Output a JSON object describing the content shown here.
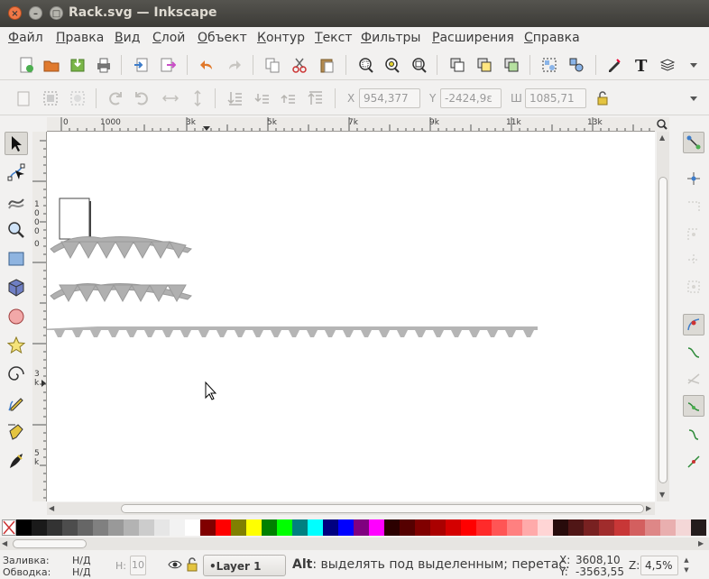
{
  "window": {
    "title": "Rack.svg — Inkscape"
  },
  "menu": [
    "Файл",
    "Правка",
    "Вид",
    "Слой",
    "Объект",
    "Контур",
    "Текст",
    "Фильтры",
    "Расширения",
    "Справка"
  ],
  "toolbar2": {
    "x_label": "X",
    "x_value": "954,377",
    "y_label": "Y",
    "y_value": "-2424,9ε",
    "w_label": "Ш",
    "w_value": "1085,71"
  },
  "ruler_top": [
    "0",
    "1000",
    "3k",
    "5k",
    "7k",
    "9k",
    "11k",
    "13k"
  ],
  "ruler_left": [
    "1",
    "0",
    "0",
    "0",
    "0",
    "3",
    "k",
    "5",
    "k"
  ],
  "status": {
    "fill_label": "Заливка:",
    "fill_value": "Н/Д",
    "stroke_label": "Обводка:",
    "stroke_value": "Н/Д",
    "opacity_label": "Н:",
    "opacity_value": "10",
    "layer": "•Layer 1",
    "message_key": "Alt",
    "message": ": выделять под выделенным; перетас.",
    "x_label": "X:",
    "x_value": "3608,10",
    "y_label": "Y:",
    "y_value": "-3563,55",
    "zoom_label": "Z:",
    "zoom_value": "4,5%"
  },
  "palette": [
    "#000000",
    "#1a1a1a",
    "#333333",
    "#4d4d4d",
    "#666666",
    "#808080",
    "#999999",
    "#b3b3b3",
    "#cccccc",
    "#e6e6e6",
    "#f2f2f2",
    "#ffffff",
    "#800000",
    "#ff0000",
    "#808000",
    "#ffff00",
    "#008000",
    "#00ff00",
    "#008080",
    "#00ffff",
    "#000080",
    "#0000ff",
    "#800080",
    "#ff00ff",
    "#2b0000",
    "#550000",
    "#800000",
    "#aa0000",
    "#d40000",
    "#ff0000",
    "#ff2a2a",
    "#ff5555",
    "#ff8080",
    "#ffaaaa",
    "#ffd5d5",
    "#280b0b",
    "#501616",
    "#782121",
    "#a02c2c",
    "#c83737",
    "#d35f5f",
    "#de8787",
    "#e9afaf",
    "#f4d7d7",
    "#241c1c"
  ]
}
